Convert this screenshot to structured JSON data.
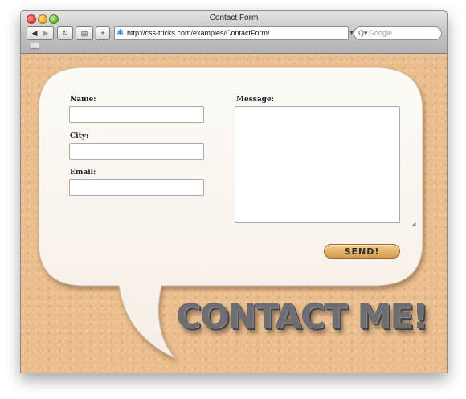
{
  "window": {
    "title": "Contact Form"
  },
  "toolbar": {
    "back_icon": "back-arrow-icon",
    "forward_icon": "forward-arrow-icon",
    "reload_icon": "reload-icon",
    "add_bookmark_label": "+",
    "address_url": "http://css-tricks.com/examples/ContactForm/",
    "search_placeholder": "Google"
  },
  "form": {
    "name_label": "Name:",
    "city_label": "City:",
    "email_label": "Email:",
    "message_label": "Message:",
    "name_value": "",
    "city_value": "",
    "email_value": "",
    "message_value": "",
    "send_label": "SEND!"
  },
  "hero": {
    "heading": "CONTACT ME!"
  },
  "colors": {
    "page_background": "#ebbd8d",
    "bubble_fill": "#fbf6f1",
    "send_button": "#e4b46c",
    "heading_text": "#6e6e72"
  }
}
